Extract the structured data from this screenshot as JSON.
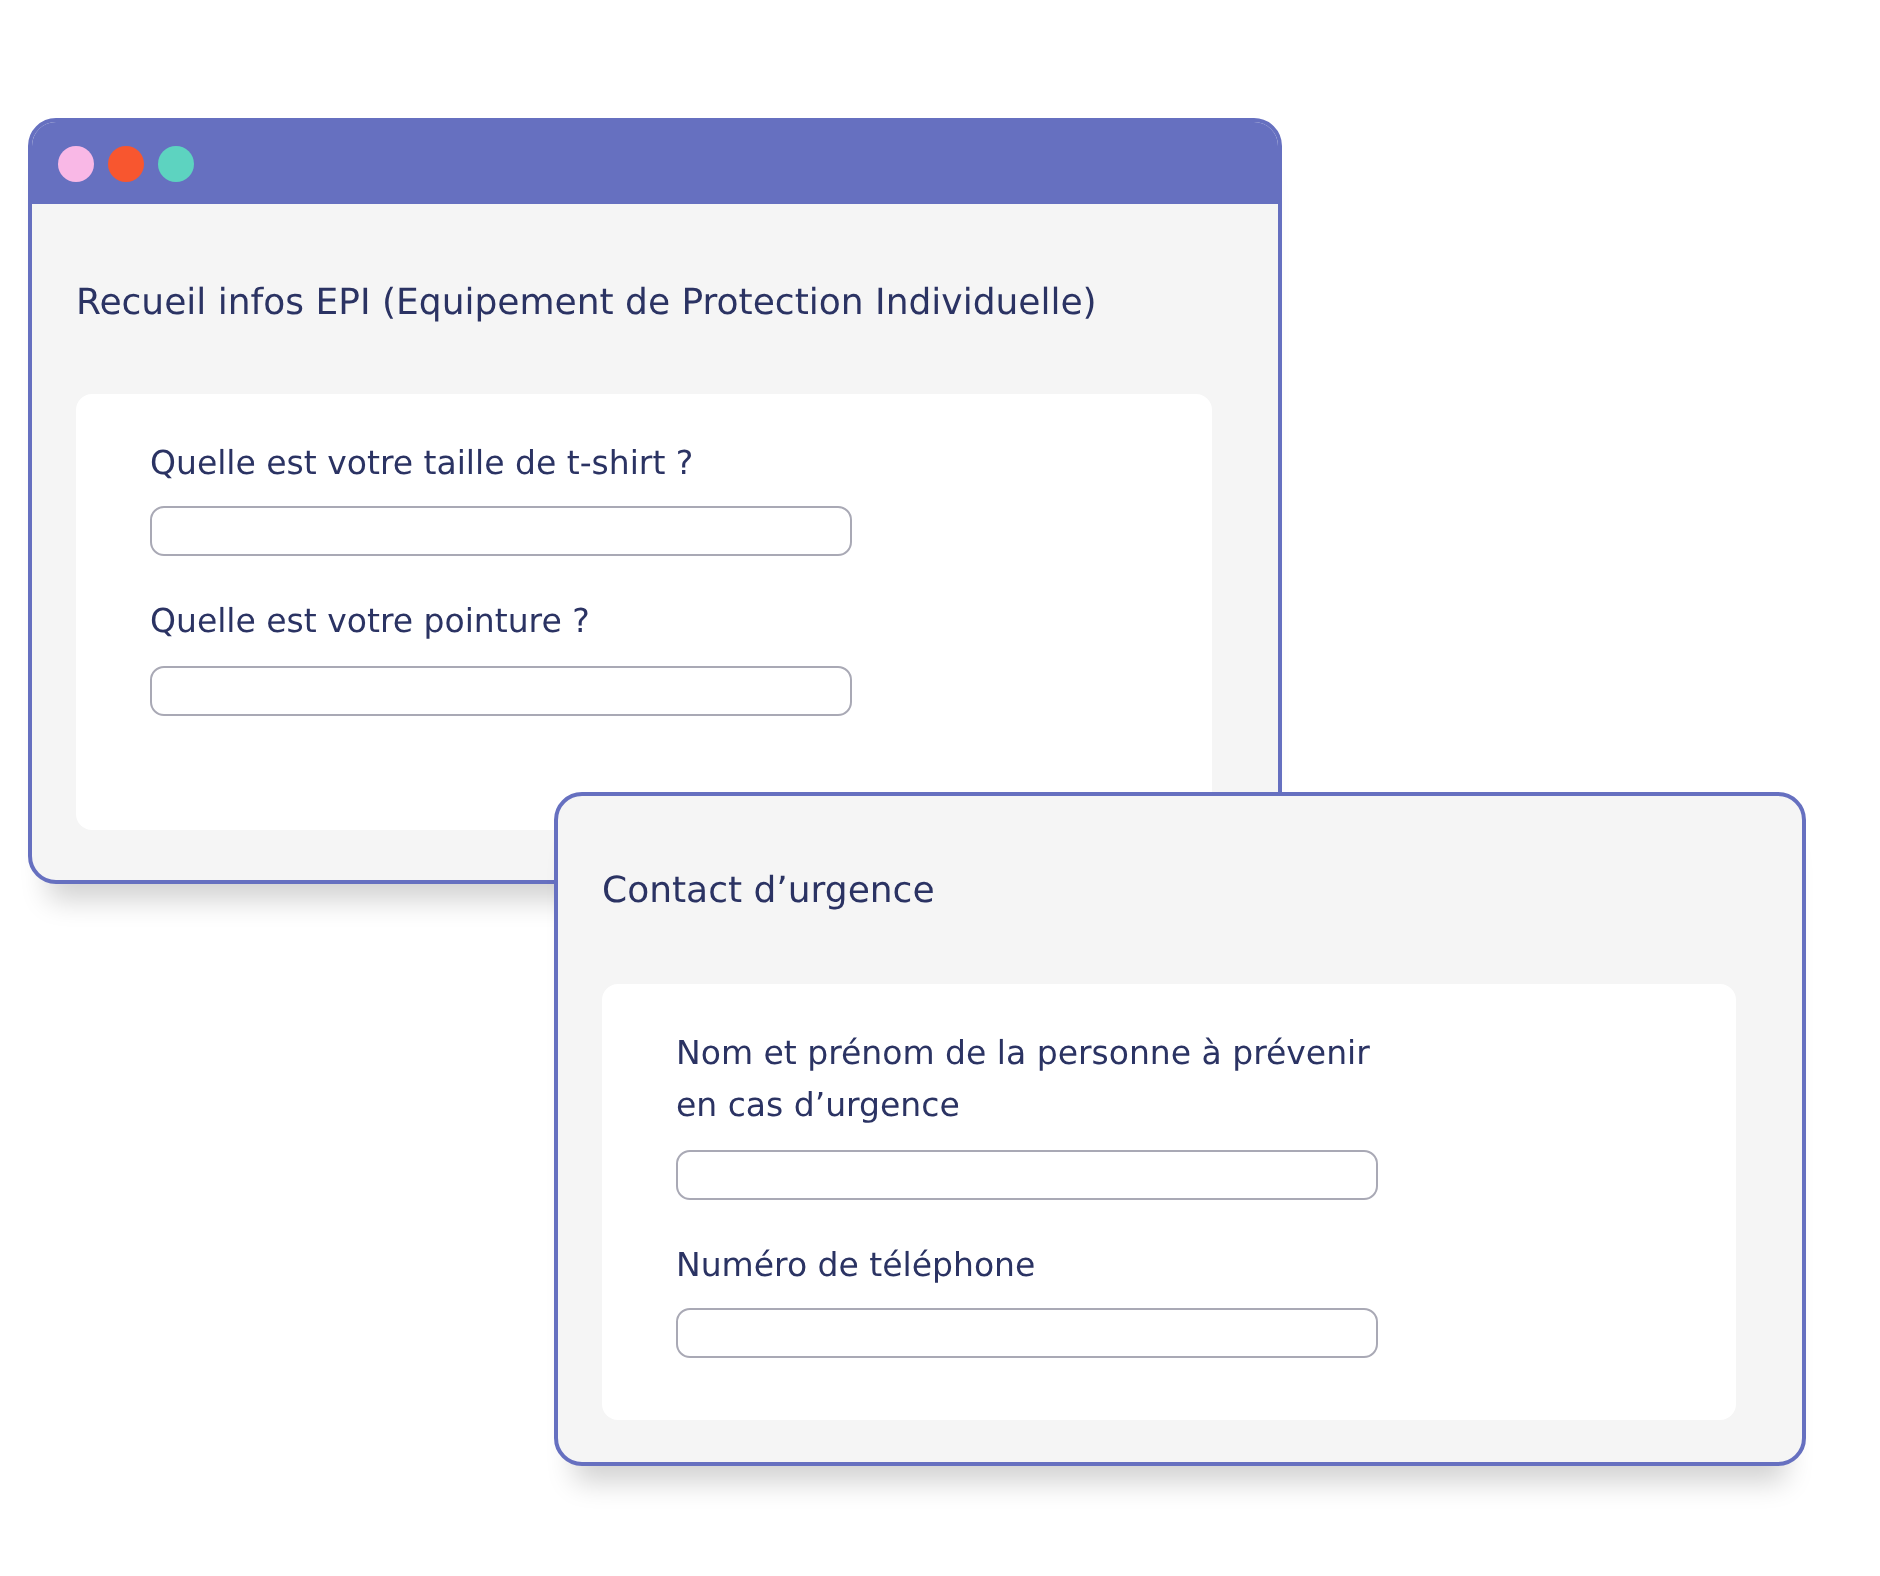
{
  "windows": [
    {
      "title_bar": {
        "dots": [
          {
            "color": "#f9b8e6"
          },
          {
            "color": "#f8562f"
          },
          {
            "color": "#5dd3c0"
          }
        ]
      },
      "heading": "Recueil infos EPI (Equipement de Protection Individuelle)",
      "questions": [
        {
          "lines": [
            "Quelle est votre taille de t-shirt ?"
          ]
        },
        {
          "lines": [
            "Quelle est votre pointure ?"
          ]
        }
      ]
    },
    {
      "heading": "Contact d’urgence",
      "questions": [
        {
          "lines": [
            "Nom et prénom de la personne à prévenir",
            "en cas d’urgence"
          ]
        },
        {
          "lines": [
            "Numéro de téléphone"
          ]
        }
      ]
    }
  ]
}
